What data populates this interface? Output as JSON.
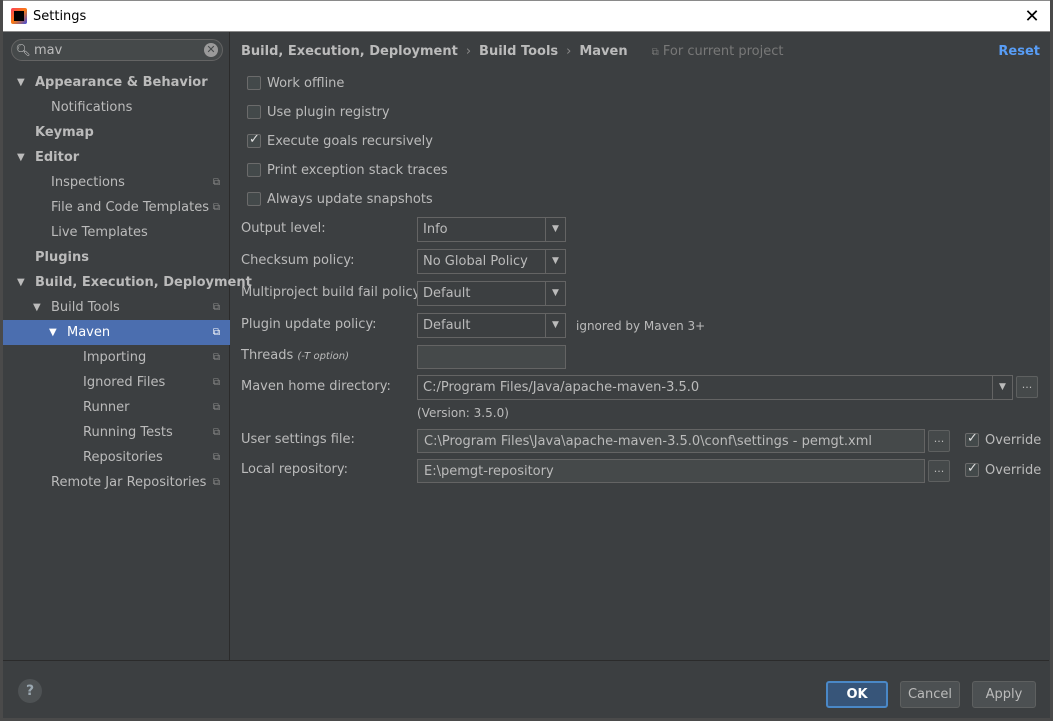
{
  "window": {
    "title": "Settings",
    "close_glyph": "✕"
  },
  "sidebar": {
    "search": {
      "value": "mav",
      "clear_glyph": "✕"
    },
    "tree": [
      {
        "label": "Appearance & Behavior",
        "bold": true,
        "level": 0,
        "expanded": true,
        "project": false,
        "selected": false
      },
      {
        "label": "Notifications",
        "bold": false,
        "level": 1,
        "expanded": null,
        "project": false,
        "selected": false
      },
      {
        "label": "Keymap",
        "bold": true,
        "level": 0,
        "expanded": null,
        "project": false,
        "selected": false
      },
      {
        "label": "Editor",
        "bold": true,
        "level": 0,
        "expanded": true,
        "project": false,
        "selected": false
      },
      {
        "label": "Inspections",
        "bold": false,
        "level": 1,
        "expanded": null,
        "project": true,
        "selected": false
      },
      {
        "label": "File and Code Templates",
        "bold": false,
        "level": 1,
        "expanded": null,
        "project": true,
        "selected": false
      },
      {
        "label": "Live Templates",
        "bold": false,
        "level": 1,
        "expanded": null,
        "project": false,
        "selected": false
      },
      {
        "label": "Plugins",
        "bold": true,
        "level": 0,
        "expanded": null,
        "project": false,
        "selected": false
      },
      {
        "label": "Build, Execution, Deployment",
        "bold": true,
        "level": 0,
        "expanded": true,
        "project": false,
        "selected": false
      },
      {
        "label": "Build Tools",
        "bold": false,
        "level": 1,
        "expanded": true,
        "project": true,
        "selected": false
      },
      {
        "label": "Maven",
        "bold": false,
        "level": 2,
        "expanded": true,
        "project": true,
        "selected": true
      },
      {
        "label": "Importing",
        "bold": false,
        "level": 3,
        "expanded": null,
        "project": true,
        "selected": false
      },
      {
        "label": "Ignored Files",
        "bold": false,
        "level": 3,
        "expanded": null,
        "project": true,
        "selected": false
      },
      {
        "label": "Runner",
        "bold": false,
        "level": 3,
        "expanded": null,
        "project": true,
        "selected": false
      },
      {
        "label": "Running Tests",
        "bold": false,
        "level": 3,
        "expanded": null,
        "project": true,
        "selected": false
      },
      {
        "label": "Repositories",
        "bold": false,
        "level": 3,
        "expanded": null,
        "project": true,
        "selected": false
      },
      {
        "label": "Remote Jar Repositories",
        "bold": false,
        "level": 1,
        "expanded": null,
        "project": true,
        "selected": false
      }
    ]
  },
  "breadcrumb": {
    "items": [
      "Build, Execution, Deployment",
      "Build Tools",
      "Maven"
    ],
    "separator": "›",
    "scope": "For current project",
    "reset": "Reset"
  },
  "checkboxes": [
    {
      "label": "Work offline",
      "checked": false
    },
    {
      "label": "Use plugin registry",
      "checked": false
    },
    {
      "label": "Execute goals recursively",
      "checked": true
    },
    {
      "label": "Print exception stack traces",
      "checked": false
    },
    {
      "label": "Always update snapshots",
      "checked": false
    }
  ],
  "form": {
    "output_level": {
      "label": "Output level:",
      "value": "Info"
    },
    "checksum_policy": {
      "label": "Checksum policy:",
      "value": "No Global Policy"
    },
    "multiproject_policy": {
      "label": "Multiproject build fail policy:",
      "value": "Default"
    },
    "plugin_update_policy": {
      "label": "Plugin update policy:",
      "value": "Default",
      "hint": "ignored by Maven 3+"
    },
    "threads": {
      "label": "Threads",
      "hint": "(-T option)",
      "value": ""
    },
    "maven_home": {
      "label": "Maven home directory:",
      "value": "C:/Program Files/Java/apache-maven-3.5.0",
      "version": "(Version: 3.5.0)"
    },
    "user_settings": {
      "label": "User settings file:",
      "value": "C:\\Program Files\\Java\\apache-maven-3.5.0\\conf\\settings - pemgt.xml",
      "override_label": "Override",
      "override": true
    },
    "local_repo": {
      "label": "Local repository:",
      "value": "E:\\pemgt-repository",
      "override_label": "Override",
      "override": true
    },
    "browse_glyph": "...",
    "dropdown_glyph": "▼"
  },
  "footer": {
    "help": "?",
    "ok": "OK",
    "cancel": "Cancel",
    "apply": "Apply"
  }
}
